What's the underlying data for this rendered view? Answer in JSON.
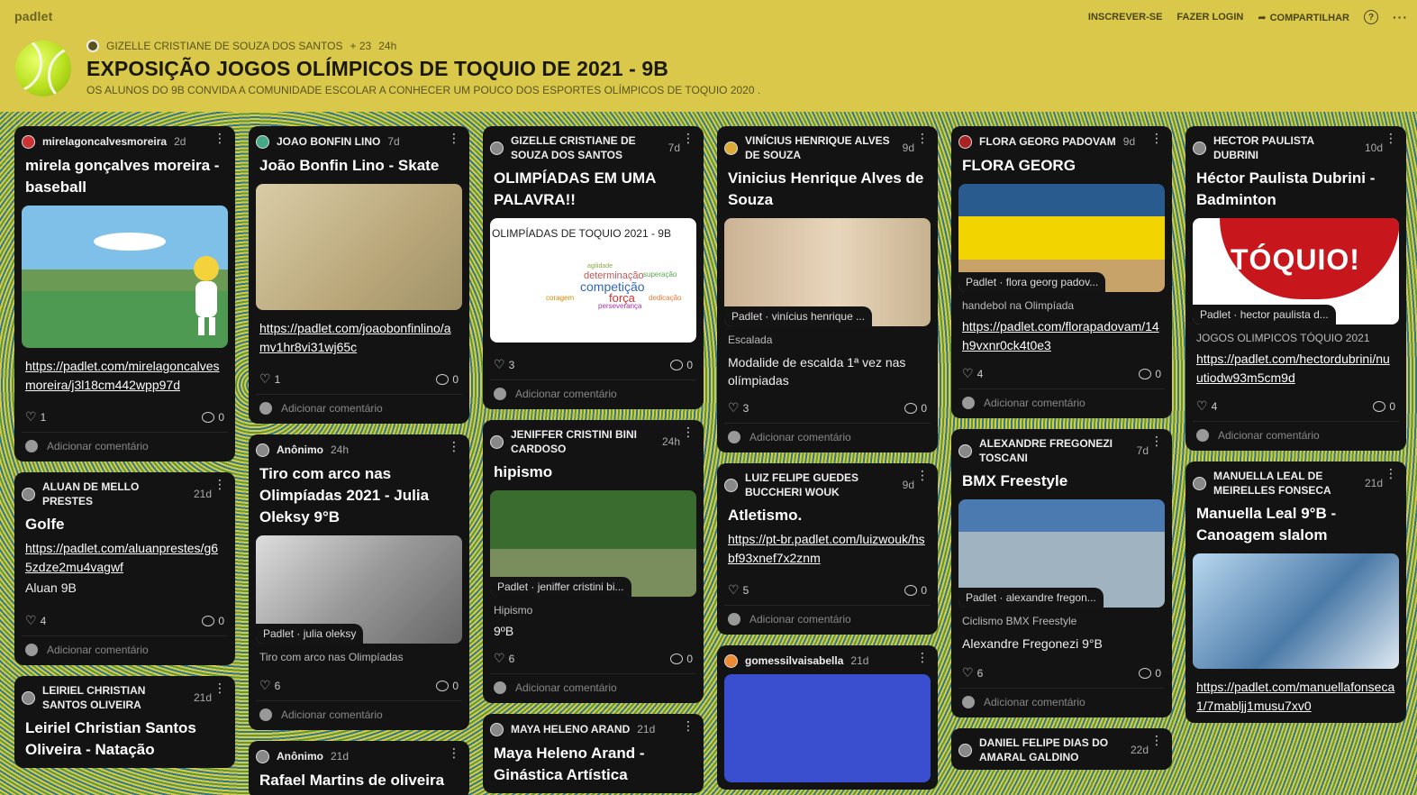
{
  "brand": "padlet",
  "nav": {
    "signup": "INSCREVER-SE",
    "login": "FAZER LOGIN",
    "share": "COMPARTILHAR",
    "help": "?",
    "more": "···"
  },
  "header": {
    "author": "GIZELLE CRISTIANE DE SOUZA DOS SANTOS",
    "count": "+ 23",
    "time": "24h",
    "title": "EXPOSIÇÃO JOGOS OLÍMPICOS DE TOQUIO DE 2021 - 9B",
    "subtitle": "OS ALUNOS DO 9B CONVIDA A COMUNIDADE ESCOLAR A CONHECER UM POUCO DOS ESPORTES OLÍMPICOS DE TOQUIO 2020 ."
  },
  "common": {
    "add_comment": "Adicionar comentário"
  },
  "cards": {
    "c1": {
      "author": "mirelagoncalvesmoreira",
      "time": "2d",
      "title": "mirela gonçalves moreira - baseball",
      "link": "https://padlet.com/mirelagoncalvesmoreira/j3l18cm442wpp97d",
      "likes": "1",
      "comments": "0"
    },
    "c2": {
      "author": "ALUAN DE MELLO PRESTES",
      "time": "21d",
      "title": "Golfe",
      "link": "https://padlet.com/aluanprestes/g65zdze2mu4vagwf",
      "text": "Aluan 9B",
      "likes": "4",
      "comments": "0"
    },
    "c3": {
      "author": "LEIRIEL CHRISTIAN SANTOS OLIVEIRA",
      "time": "21d",
      "title": "Leiriel Christian Santos Oliveira - Natação"
    },
    "c4": {
      "author": "JOAO BONFIN LINO",
      "time": "7d",
      "title": "João Bonfin Lino - Skate",
      "link": "https://padlet.com/joaobonfinlino/amv1hr8vi31wj65c",
      "likes": "1",
      "comments": "0"
    },
    "c5": {
      "author": "Anônimo",
      "time": "24h",
      "title": "Tiro com arco nas Olimpíadas 2021 - Julia Oleksy 9°B",
      "caption": "Padlet · julia oleksy",
      "small": "Tiro com arco nas Olimpíadas",
      "likes": "6",
      "comments": "0"
    },
    "c6": {
      "author": "Anônimo",
      "time": "21d",
      "title": "Rafael Martins de oliveira"
    },
    "c7": {
      "author": "GIZELLE CRISTIANE DE SOUZA DOS SANTOS",
      "time": "7d",
      "title": "OLIMPÍADAS EM UMA PALAVRA!!",
      "image_heading": "OLIMPÍADAS DE TOQUIO 2021 - 9B",
      "words": [
        "agilidade",
        "determinação",
        "competição",
        "força",
        "perseverança",
        "coragem",
        "superação",
        "dedicação"
      ],
      "likes": "3",
      "comments": "0"
    },
    "c8": {
      "author": "JENIFFER CRISTINI BINI CARDOSO",
      "time": "24h",
      "title": "hipismo",
      "caption": "Padlet · jeniffer cristini bi...",
      "small": "Hipismo",
      "text": "9ºB",
      "likes": "6",
      "comments": "0"
    },
    "c9": {
      "author": "MAYA HELENO ARAND",
      "time": "21d",
      "title": "Maya Heleno Arand - Ginástica Artística"
    },
    "c10": {
      "author": "VINÍCIUS HENRIQUE ALVES DE SOUZA",
      "time": "9d",
      "title": "Vinicius Henrique Alves de Souza",
      "caption": "Padlet · vinícius henrique ...",
      "small": "Escalada",
      "text": "Modalide de escalda 1ª vez nas olímpiadas",
      "likes": "3",
      "comments": "0"
    },
    "c11": {
      "author": "LUIZ FELIPE GUEDES BUCCHERI WOUK",
      "time": "9d",
      "title": "Atletismo.",
      "link": "https://pt-br.padlet.com/luizwouk/hsbf93xnef7x2znm",
      "likes": "5",
      "comments": "0"
    },
    "c12": {
      "author": "gomessilvaisabella",
      "time": "21d"
    },
    "c13": {
      "author": "FLORA GEORG PADOVAM",
      "time": "9d",
      "title": "FLORA GEORG",
      "caption": "Padlet · flora georg padov...",
      "small": "handebol na Olimpíada",
      "link": "https://padlet.com/florapadovam/14h9vxnr0ck4t0e3",
      "likes": "4",
      "comments": "0"
    },
    "c14": {
      "author": "ALEXANDRE FREGONEZI TOSCANI",
      "time": "7d",
      "title": "BMX Freestyle",
      "caption": "Padlet · alexandre fregon...",
      "small": "Ciclismo BMX Freestyle",
      "text": "Alexandre Fregonezi  9°B",
      "likes": "6",
      "comments": "0"
    },
    "c15": {
      "author": "DANIEL FELIPE DIAS DO AMARAL GALDINO",
      "time": "22d"
    },
    "c16": {
      "author": "HECTOR PAULISTA DUBRINI",
      "time": "10d",
      "title": "Héctor Paulista Dubrini - Badminton",
      "image_text": "TÓQUIO!",
      "caption": "Padlet · hector paulista d...",
      "small": "JOGOS OLIMPICOS TÓQUIO 2021",
      "link": "https://padlet.com/hectordubrini/nuutiodw93m5cm9d",
      "likes": "4",
      "comments": "0"
    },
    "c17": {
      "author": "MANUELLA LEAL DE MEIRELLES FONSECA",
      "time": "21d",
      "title": "Manuella Leal 9°B - Canoagem slalom",
      "link": "https://padlet.com/manuellafonseca1/7mabljj1musu7xv0"
    }
  }
}
